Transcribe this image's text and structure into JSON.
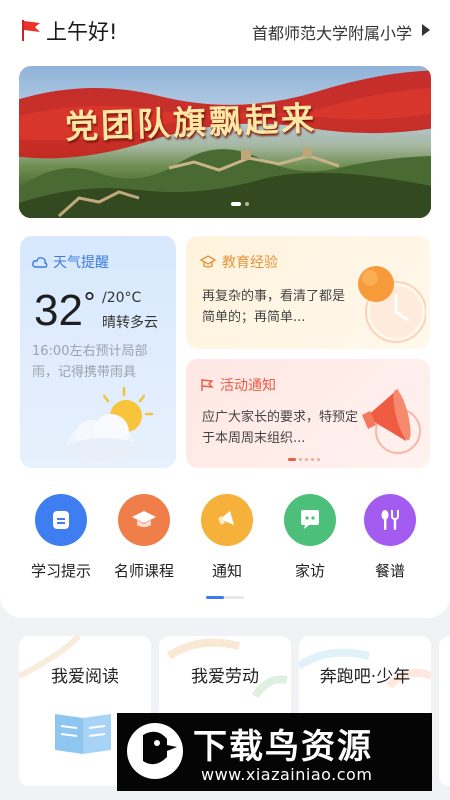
{
  "header": {
    "greeting": "上午好!",
    "school": "首都师范大学附属小学",
    "flag_icon": "red-flag-icon",
    "arrow_icon": "triangle-right-icon"
  },
  "banner": {
    "title": "党团队旗飘起来",
    "dots": 2,
    "active_dot": 0
  },
  "weather": {
    "label": "天气提醒",
    "temperature": "32",
    "degree": "°",
    "low": "/20°C",
    "condition": "晴转多云",
    "tip": "16:00左右预计局部雨，记得携带雨具",
    "icon": "cloud-icon"
  },
  "education": {
    "label": "教育经验",
    "text": "再复杂的事，看清了都是简单的；再简单...",
    "icon": "graduation-cap-icon"
  },
  "activity": {
    "label": "活动通知",
    "text": "应广大家长的要求，特预定于本周周末组织...",
    "icon": "flag-icon",
    "dots": 5,
    "active_dot": 0
  },
  "quick_menu": [
    {
      "label": "学习提示",
      "icon": "study-tip-icon",
      "color": "#3f7ef0"
    },
    {
      "label": "名师课程",
      "icon": "mortarboard-icon",
      "color": "#f07e4a"
    },
    {
      "label": "通知",
      "icon": "notice-icon",
      "color": "#f5b13a"
    },
    {
      "label": "家访",
      "icon": "chat-bubble-icon",
      "color": "#4cc07a"
    },
    {
      "label": "餐谱",
      "icon": "fork-spoon-icon",
      "color": "#a35bf0"
    }
  ],
  "bottom_cards": [
    {
      "title": "我爱阅读"
    },
    {
      "title": "我爱劳动"
    },
    {
      "title": "奔跑吧·少年"
    }
  ],
  "watermark": {
    "title": "下载鸟资源",
    "url": "www.xiazainiao.com"
  },
  "colors": {
    "primary_blue": "#3a7cf0",
    "weather_blue": "#3d7ae0",
    "edu_orange": "#e6953a",
    "activity_red": "#ec5a43"
  }
}
